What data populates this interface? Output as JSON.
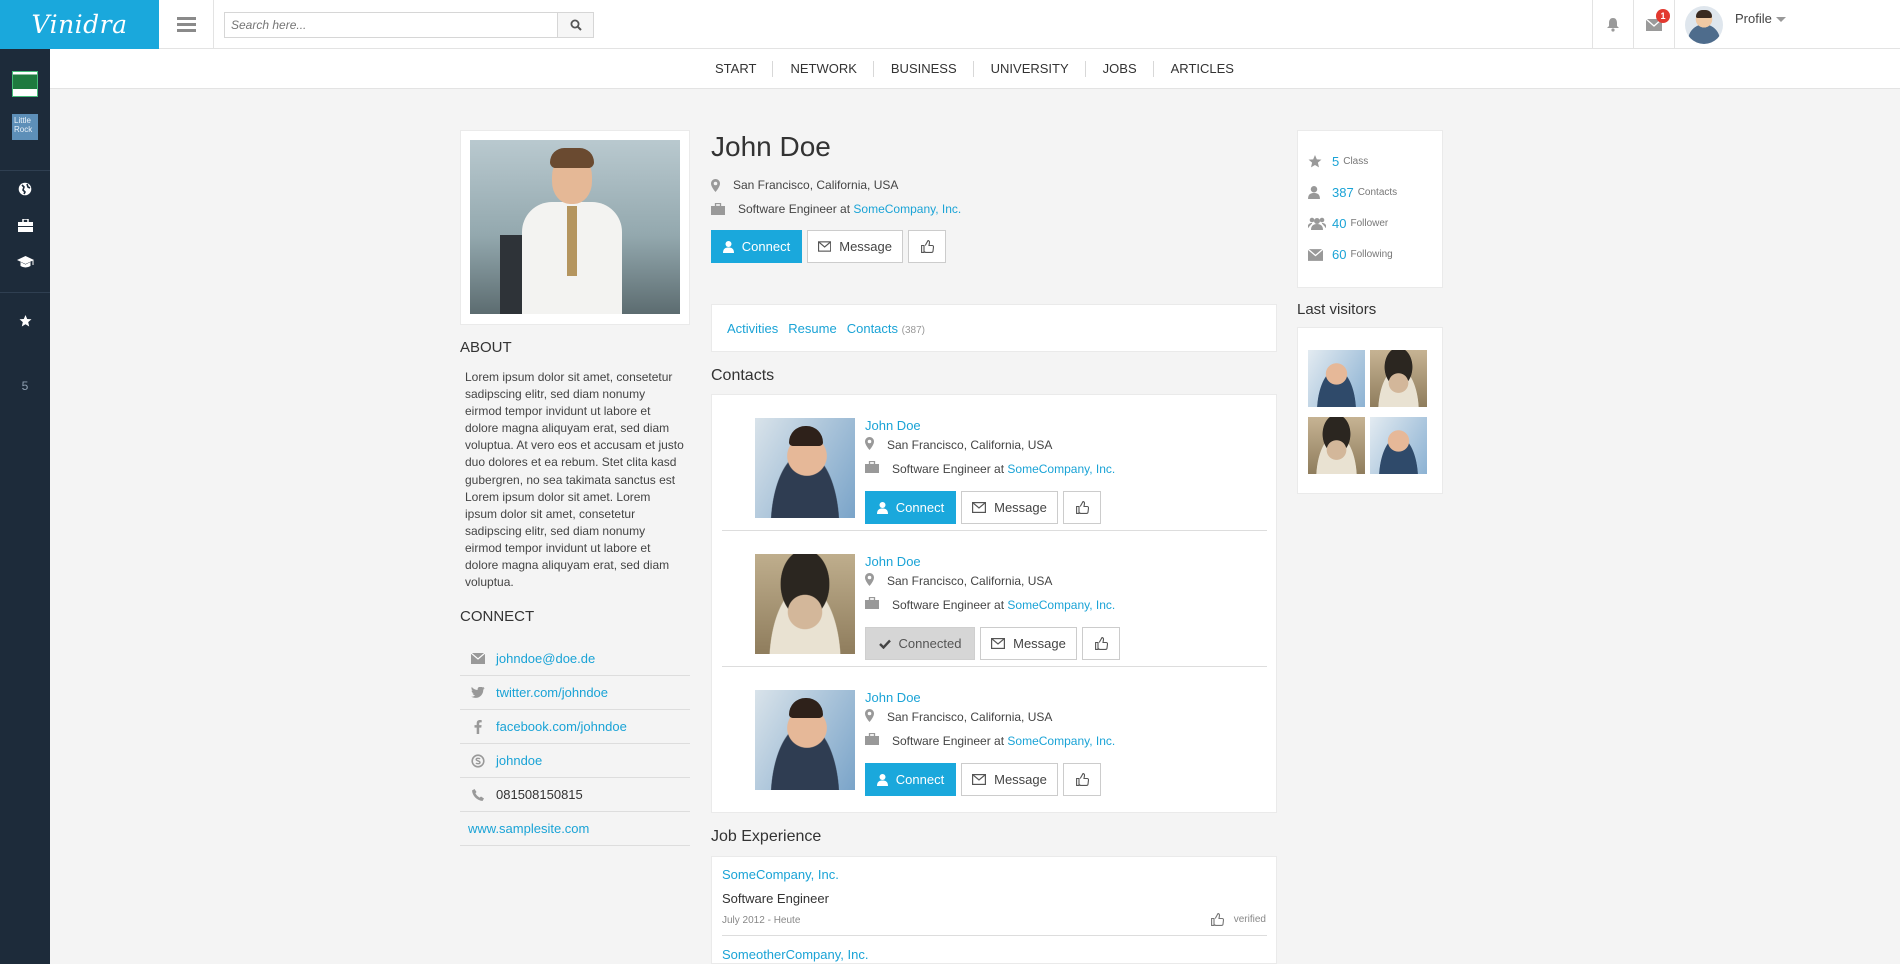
{
  "app": {
    "brand": "Vinidra"
  },
  "search": {
    "placeholder": "Search here..."
  },
  "header": {
    "notification_count": "1",
    "profile_label": "Profile"
  },
  "sidebar": {
    "favorites_count": "5",
    "logo2_text": "Little Rock"
  },
  "nav": [
    "START",
    "NETWORK",
    "BUSINESS",
    "UNIVERSITY",
    "JOBS",
    "ARTICLES"
  ],
  "profile": {
    "name": "John Doe",
    "location": "San Francisco, California, USA",
    "job_prefix": "Software Engineer at",
    "company": "SomeCompany, Inc.",
    "connect_label": "Connect",
    "message_label": "Message"
  },
  "about": {
    "title": "ABOUT",
    "text": "Lorem ipsum dolor sit amet, consetetur sadipscing elitr, sed diam nonumy eirmod tempor invidunt ut labore et dolore magna aliquyam erat, sed diam voluptua. At vero eos et accusam et justo duo dolores et ea rebum. Stet clita kasd gubergren, no sea takimata sanctus est Lorem ipsum dolor sit amet. Lorem ipsum dolor sit amet, consetetur sadipscing elitr, sed diam nonumy eirmod tempor invidunt ut labore et dolore magna aliquyam erat, sed diam voluptua."
  },
  "connect": {
    "title": "CONNECT",
    "email": "johndoe@doe.de",
    "twitter": "twitter.com/johndoe",
    "facebook": "facebook.com/johndoe",
    "skype": "johndoe",
    "phone": "081508150815",
    "website": "www.samplesite.com"
  },
  "tabs": {
    "activities": "Activities",
    "resume": "Resume",
    "contacts": "Contacts",
    "contacts_count": "(387)"
  },
  "contacts": {
    "title": "Contacts",
    "items": [
      {
        "name": "John Doe",
        "location": "San Francisco, California, USA",
        "job_prefix": "Software Engineer at",
        "company": "SomeCompany, Inc.",
        "action": "Connect",
        "message": "Message"
      },
      {
        "name": "John Doe",
        "location": "San Francisco, California, USA",
        "job_prefix": "Software Engineer at",
        "company": "SomeCompany, Inc.",
        "action": "Connected",
        "message": "Message"
      },
      {
        "name": "John Doe",
        "location": "San Francisco, California, USA",
        "job_prefix": "Software Engineer at",
        "company": "SomeCompany, Inc.",
        "action": "Connect",
        "message": "Message"
      }
    ]
  },
  "jobs": {
    "title": "Job Experience",
    "items": [
      {
        "company": "SomeCompany, Inc.",
        "title": "Software Engineer",
        "date": "July 2012 - Heute",
        "status": "verified"
      },
      {
        "company": "SomeotherCompany, Inc."
      }
    ]
  },
  "stats": [
    {
      "value": "5",
      "label": "Class"
    },
    {
      "value": "387",
      "label": "Contacts"
    },
    {
      "value": "40",
      "label": "Follower"
    },
    {
      "value": "60",
      "label": "Following"
    }
  ],
  "visitors": {
    "title": "Last visitors"
  },
  "colors": {
    "brand": "#1aa8dc",
    "link": "#1aa3d6",
    "sidebar": "#1d2b3a",
    "badge": "#e2392f"
  }
}
